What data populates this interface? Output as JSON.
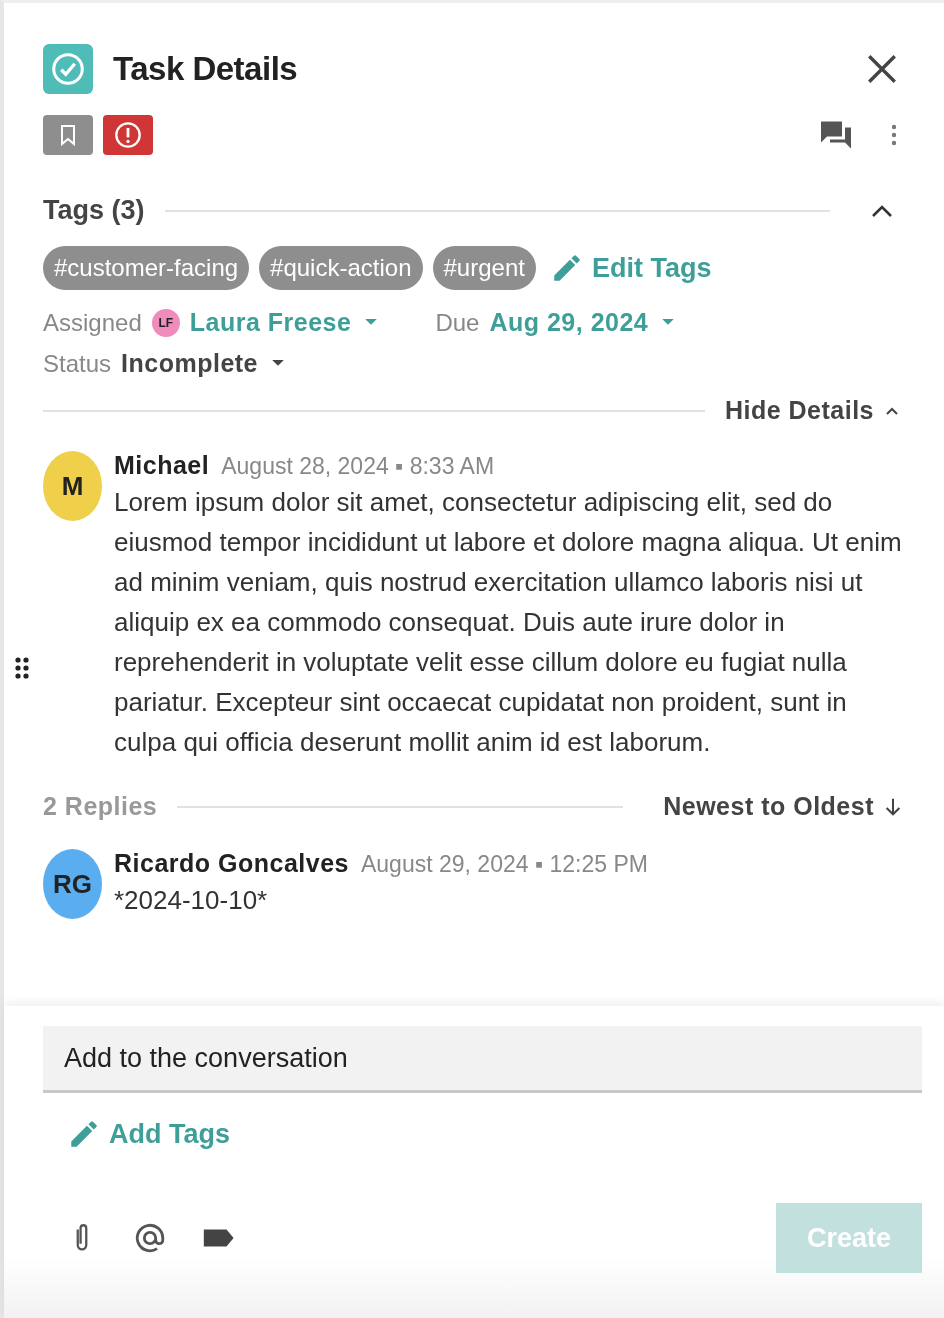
{
  "header": {
    "title": "Task Details"
  },
  "tags": {
    "title": "Tags (3)",
    "expanded": true,
    "items": [
      "#customer-facing",
      "#quick-action",
      "#urgent"
    ],
    "edit_label": "Edit Tags"
  },
  "details": {
    "assigned_label": "Assigned",
    "assignee": {
      "initials": "LF",
      "name": "Laura Freese",
      "color": "#f08cbc"
    },
    "due_label": "Due",
    "due": "Aug 29, 2024",
    "status_label": "Status",
    "status": "Incomplete",
    "toggle_label": "Hide Details",
    "expanded": true
  },
  "comment": {
    "initials": "M",
    "color": "#f0d04a",
    "author": "Michael",
    "timestamp": "August 28, 2024 ▪ 8:33 AM",
    "body": "Lorem ipsum dolor sit amet, consectetur adipiscing elit, sed do eiusmod tempor incididunt ut labore et dolore magna aliqua. Ut enim ad minim veniam, quis nostrud exercitation ullamco laboris nisi ut aliquip ex ea commodo consequat. Duis aute irure dolor in reprehenderit in voluptate velit esse cillum dolore eu fugiat nulla pariatur. Excepteur sint occaecat cupidatat non proident, sunt in culpa qui officia deserunt mollit anim id est laborum."
  },
  "replies": {
    "count": "2 Replies",
    "sort": "Newest to Oldest",
    "items": [
      {
        "initials": "RG",
        "color": "#5aaef0",
        "author": "Ricardo Goncalves",
        "timestamp": "August 29, 2024 ▪ 12:25 PM",
        "body": "*2024-10-10*"
      }
    ]
  },
  "composer": {
    "placeholder": "Add to the conversation",
    "add_tags": "Add Tags",
    "create": {
      "label": "Create",
      "disabled": true
    }
  }
}
